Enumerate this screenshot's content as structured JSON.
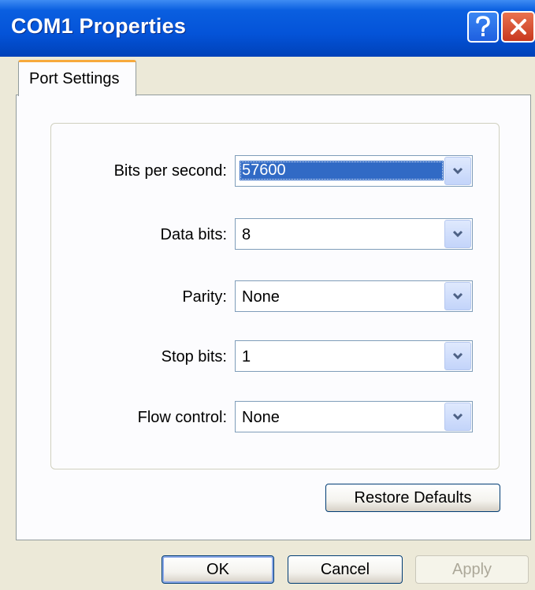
{
  "window": {
    "title": "COM1 Properties"
  },
  "tabs": [
    {
      "label": "Port Settings",
      "active": true
    }
  ],
  "settings": {
    "bits_per_second": {
      "label": "Bits per second:",
      "value": "57600"
    },
    "data_bits": {
      "label": "Data bits:",
      "value": "8"
    },
    "parity": {
      "label": "Parity:",
      "value": "None"
    },
    "stop_bits": {
      "label": "Stop bits:",
      "value": "1"
    },
    "flow_control": {
      "label": "Flow control:",
      "value": "None"
    }
  },
  "buttons": {
    "restore_defaults": "Restore Defaults",
    "ok": "OK",
    "cancel": "Cancel",
    "apply": "Apply"
  },
  "icons": {
    "help": "help-icon",
    "close": "close-icon",
    "dropdown": "chevron-down-icon"
  },
  "colors": {
    "titlebar": "#0453d8",
    "tab_highlight": "#f7a93c",
    "selection": "#316ac5"
  }
}
